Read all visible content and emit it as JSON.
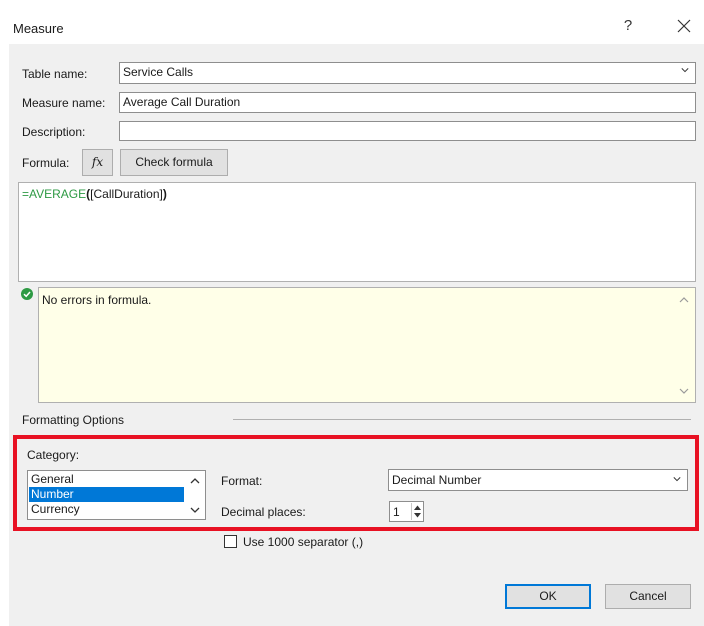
{
  "window": {
    "title": "Measure",
    "help_label": "?",
    "close_label": "✕"
  },
  "form": {
    "table_name_label": "Table name:",
    "table_name_value": "Service Calls",
    "measure_name_label": "Measure name:",
    "measure_name_value": "Average Call Duration",
    "description_label": "Description:",
    "description_value": "",
    "formula_label": "Formula:",
    "fx_label": "fx",
    "check_formula_label": "Check formula"
  },
  "formula": {
    "prefix": "=",
    "function": "AVERAGE",
    "open_paren": "(",
    "argument": "[CallDuration]",
    "close_paren": ")"
  },
  "status": {
    "message": "No errors in formula.",
    "icon": "check-circle-icon",
    "icon_color": "#2e9a44"
  },
  "formatting": {
    "section_label": "Formatting Options",
    "category_label": "Category:",
    "categories": [
      "General",
      "Number",
      "Currency"
    ],
    "selected_category": "Number",
    "format_label": "Format:",
    "format_value": "Decimal Number",
    "decimal_places_label": "Decimal places:",
    "decimal_places_value": "1",
    "separator_label": "Use 1000 separator (,)",
    "separator_checked": false
  },
  "buttons": {
    "ok_label": "OK",
    "cancel_label": "Cancel"
  },
  "colors": {
    "highlight": "#e81123",
    "selection": "#0078d7",
    "function_text": "#2e9a44"
  }
}
